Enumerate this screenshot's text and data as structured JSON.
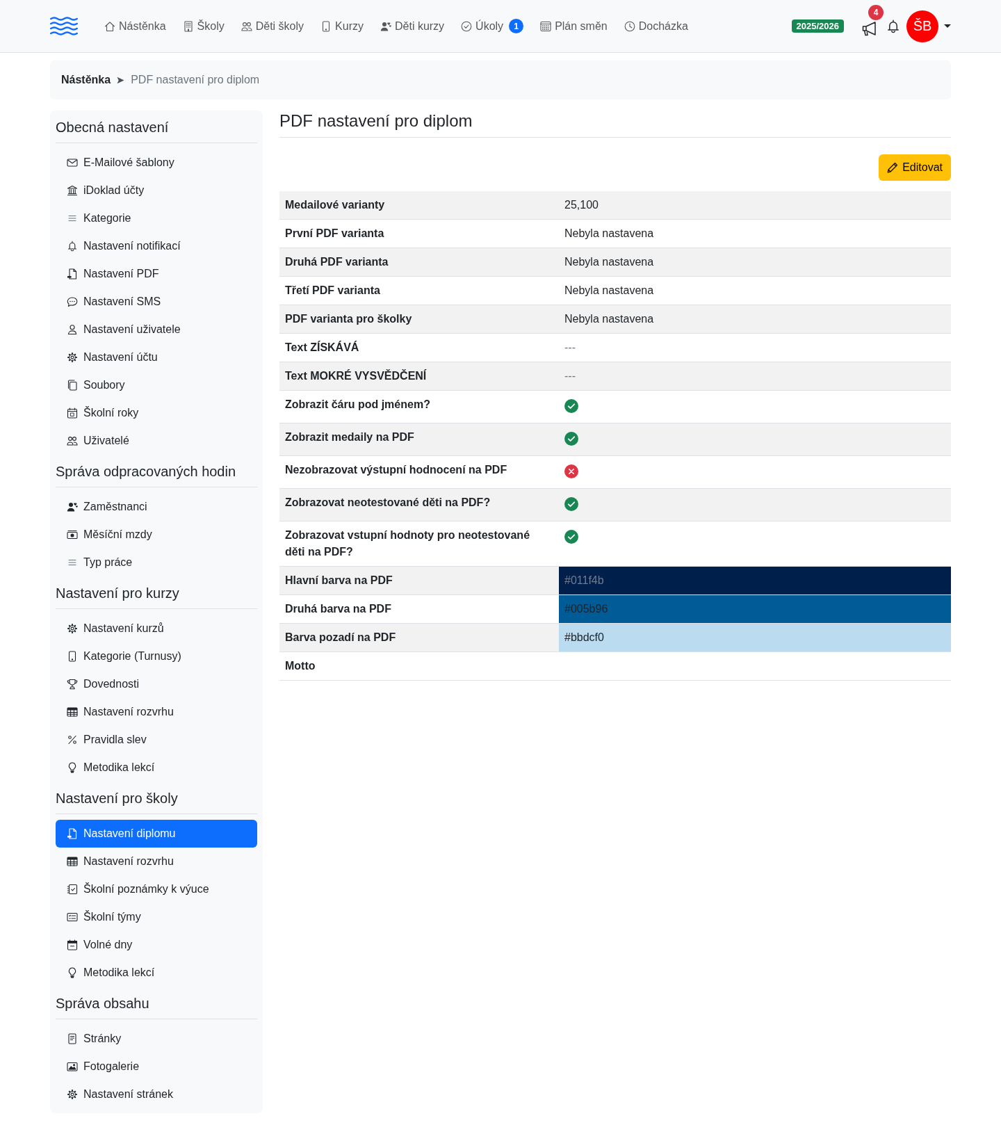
{
  "navbar": {
    "nav_items": [
      {
        "label": "Nástěnka"
      },
      {
        "label": "Školy"
      },
      {
        "label": "Děti školy"
      },
      {
        "label": "Kurzy"
      },
      {
        "label": "Děti kurzy"
      },
      {
        "label": "Úkoly",
        "badge": "1"
      },
      {
        "label": "Plán směn"
      },
      {
        "label": "Docházka"
      }
    ],
    "school_year": "2025/2026",
    "announcements_badge": "4",
    "avatar_initials": "ŠB"
  },
  "breadcrumb": [
    {
      "label": "Nástěnka",
      "current": false
    },
    {
      "label": "PDF nastavení pro diplom",
      "current": true
    }
  ],
  "sidebar": {
    "sections": [
      {
        "title": "Obecná nastavení",
        "items": [
          {
            "label": "E-Mailové šablony",
            "selected": false
          },
          {
            "label": "iDoklad účty",
            "selected": false
          },
          {
            "label": "Kategorie",
            "selected": false
          },
          {
            "label": "Nastavení notifikací",
            "selected": false
          },
          {
            "label": "Nastavení PDF",
            "selected": false
          },
          {
            "label": "Nastavení SMS",
            "selected": false
          },
          {
            "label": "Nastavení uživatele",
            "selected": false
          },
          {
            "label": "Nastavení účtu",
            "selected": false
          },
          {
            "label": "Soubory",
            "selected": false
          },
          {
            "label": "Školní roky",
            "selected": false
          },
          {
            "label": "Uživatelé",
            "selected": false
          }
        ]
      },
      {
        "title": "Správa odpracovaných hodin",
        "items": [
          {
            "label": "Zaměstnanci",
            "selected": false
          },
          {
            "label": "Měsíční mzdy",
            "selected": false
          },
          {
            "label": "Typ práce",
            "selected": false
          }
        ]
      },
      {
        "title": "Nastavení pro kurzy",
        "items": [
          {
            "label": "Nastavení kurzů",
            "selected": false
          },
          {
            "label": "Kategorie (Turnusy)",
            "selected": false
          },
          {
            "label": "Dovednosti",
            "selected": false
          },
          {
            "label": "Nastavení rozvrhu",
            "selected": false
          },
          {
            "label": "Pravidla slev",
            "selected": false
          },
          {
            "label": "Metodika lekcí",
            "selected": false
          }
        ]
      },
      {
        "title": "Nastavení pro školy",
        "items": [
          {
            "label": "Nastavení diplomu",
            "selected": true
          },
          {
            "label": "Nastavení rozvrhu",
            "selected": false
          },
          {
            "label": "Školní poznámky k výuce",
            "selected": false
          },
          {
            "label": "Školní týmy",
            "selected": false
          },
          {
            "label": "Volné dny",
            "selected": false
          },
          {
            "label": "Metodika lekcí",
            "selected": false
          }
        ]
      },
      {
        "title": "Správa obsahu",
        "items": [
          {
            "label": "Stránky",
            "selected": false
          },
          {
            "label": "Fotogalerie",
            "selected": false
          },
          {
            "label": "Nastavení stránek",
            "selected": false
          }
        ]
      }
    ]
  },
  "content": {
    "title": "PDF nastavení pro diplom",
    "edit_button": "Editovat",
    "rows": [
      {
        "label": "Medailové varianty",
        "kind": "text",
        "value": "25,100"
      },
      {
        "label": "První PDF varianta",
        "kind": "text",
        "value": "Nebyla nastavena"
      },
      {
        "label": "Druhá PDF varianta",
        "kind": "text",
        "value": "Nebyla nastavena"
      },
      {
        "label": "Třetí PDF varianta",
        "kind": "text",
        "value": "Nebyla nastavena"
      },
      {
        "label": "PDF varianta pro školky",
        "kind": "text",
        "value": "Nebyla nastavena"
      },
      {
        "label": "Text ZÍSKÁVÁ",
        "kind": "empty",
        "value": "---"
      },
      {
        "label": "Text MOKRÉ VYSVĚDČENÍ",
        "kind": "empty",
        "value": "---"
      },
      {
        "label": "Zobrazit čáru pod jménem?",
        "kind": "boolean",
        "on": true
      },
      {
        "label": "Zobrazit medaily na PDF",
        "kind": "boolean",
        "on": true
      },
      {
        "label": "Nezobrazovat výstupní hodnocení na PDF",
        "kind": "boolean",
        "on": false
      },
      {
        "label": "Zobrazovat neotestované děti na PDF?",
        "kind": "boolean",
        "on": true
      },
      {
        "label": "Zobrazovat vstupní hodnoty pro neotestované děti na PDF?",
        "kind": "boolean",
        "on": true
      },
      {
        "label": "Hlavní barva na PDF",
        "kind": "color",
        "value": "#011f4b",
        "color": "#011f4b"
      },
      {
        "label": "Druhá barva na PDF",
        "kind": "color",
        "value": "#005b96",
        "color": "#005b96"
      },
      {
        "label": "Barva pozadí na PDF",
        "kind": "color",
        "value": "#bbdcf0",
        "color": "#bbdcf0"
      },
      {
        "label": "Motto",
        "kind": "text"
      }
    ]
  }
}
